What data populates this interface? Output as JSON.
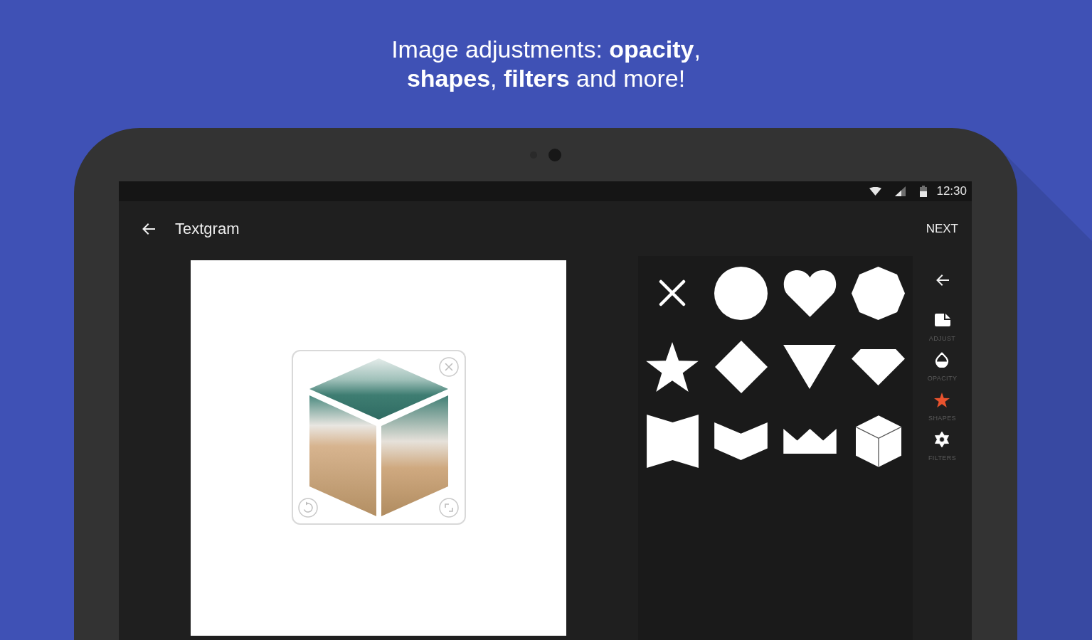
{
  "headline": "Image adjustments: **opacity**, **shapes**, **filters** and more!",
  "status_bar": {
    "time": "12:30"
  },
  "app_bar": {
    "title": "Textgram",
    "action": "NEXT"
  },
  "shape_grid": {
    "items": [
      {
        "kind": "none"
      },
      {
        "kind": "circle"
      },
      {
        "kind": "heart"
      },
      {
        "kind": "octagon"
      },
      {
        "kind": "star"
      },
      {
        "kind": "diamond"
      },
      {
        "kind": "triangle"
      },
      {
        "kind": "gem"
      },
      {
        "kind": "banner"
      },
      {
        "kind": "chevron"
      },
      {
        "kind": "crown"
      },
      {
        "kind": "cube"
      }
    ]
  },
  "tool_rail": {
    "items": [
      {
        "kind": "adjust",
        "label": "ADJUST",
        "selected": false
      },
      {
        "kind": "opacity",
        "label": "OPACITY",
        "selected": false
      },
      {
        "kind": "shapes",
        "label": "SHAPES",
        "selected": true
      },
      {
        "kind": "filters",
        "label": "FILTERS",
        "selected": false
      }
    ]
  }
}
